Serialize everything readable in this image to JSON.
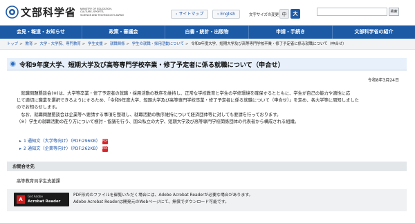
{
  "header": {
    "logo_text": "文部科学省",
    "logo_en": [
      "MINISTRY OF EDUCATION,",
      "CULTURE, SPORTS,",
      "SCIENCE AND TECHNOLOGY-JAPAN"
    ],
    "sitemap_label": "サイトマップ",
    "english_label": "English",
    "font_size_label": "文字サイズの変更",
    "font_small": "中",
    "font_large": "大",
    "search_placeholder": "",
    "search_button": "検索"
  },
  "nav": {
    "items": [
      "会見・報道・お知らせ",
      "政策・審議会",
      "白書・統計・出版物",
      "申請・手続き",
      "文部科学省の紹介"
    ]
  },
  "breadcrumb": {
    "items": [
      "トップ",
      "教育",
      "大学・大学院、専門教育",
      "学生支援",
      "就職関係",
      "学生の就職・採用活動について"
    ],
    "current": "令和9年度大学、短期大学及び高等専門学校卒業・修了予定者に係る就職について（申合せ）"
  },
  "page": {
    "title": "令和9年度大学、短期大学及び高等専門学校卒業・修了予定者に係る就職について（申合せ）",
    "date": "令和8年3月24日",
    "paragraphs": [
      "　就職問題懇談会(※)は、大学等卒業・修了予定者の就職・採用活動の秩序を維持し、正常な学校教育と学生の学修環境を確保するとともに、学生が自己の能力や適性に応",
      "じて適切に職業を選択できるようにするため、「令和9年度大学、短期大学及び高等専門学校卒業・修了予定者に係る就職について（申合せ）」を定め、各大学等に周知しました",
      "のでお知らせします。",
      "　なお、就職問題懇談会は企業等へ要請する事項を整理し、就職活動の秩序維持について経済団体等に対しても要請を行っております。",
      "（※）学生の就職活動の在り方について検討・協議を行う、国公私立の大学、短期大学及び高等専門学校関係団体の代表者から構成される組織。"
    ],
    "links": [
      {
        "label": "1 通知文（大学等向け）（PDF:296KB）",
        "pdf": "PDF"
      },
      {
        "label": "2 通知文（企業等向け）（PDF:262KB）",
        "pdf": "PDF"
      }
    ]
  },
  "contact": {
    "heading": "お問合せ先",
    "department": "高等教育局学生支援課"
  },
  "adobe": {
    "get_label": "Get Adobe",
    "reader_label": "Acrobat Reader",
    "text_line1": "PDF形式のファイルを御覧いただく場合には、Adobe Acrobat Readerが必要な場合があります。",
    "text_line2": "Adobe Acrobat Readerは開発元のWebページにて、無償でダウンロード可能です。"
  },
  "colors": {
    "nav_bg": "#1c5aa6",
    "link": "#1a54a8",
    "pdf_red": "#d7272c"
  }
}
